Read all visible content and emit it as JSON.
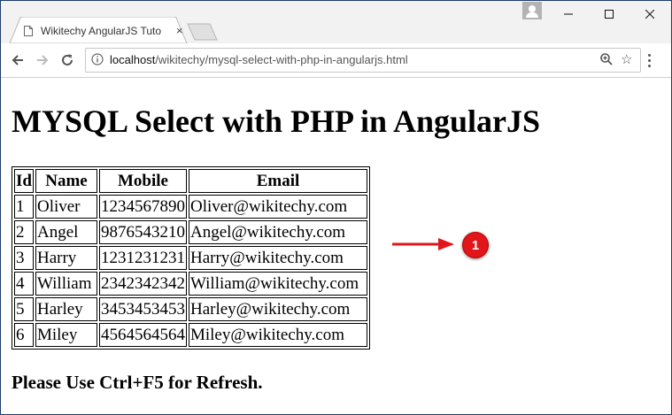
{
  "browser": {
    "tab_title": "Wikitechy AngularJS Tuto",
    "tab_close": "×",
    "url_host": "localhost",
    "url_path": "/wikitechy/mysql-select-with-php-in-angularjs.html",
    "window_controls": {
      "minimize": "—",
      "maximize": "☐",
      "close": "✕"
    },
    "icons": [
      "back-arrow-icon",
      "forward-arrow-icon",
      "reload-icon",
      "info-icon",
      "zoom-icon",
      "star-icon",
      "menu-icon",
      "profile-icon"
    ]
  },
  "page": {
    "heading": "MYSQL Select with PHP in AngularJS",
    "table": {
      "headers": [
        "Id",
        "Name",
        "Mobile",
        "Email"
      ],
      "rows": [
        [
          "1",
          "Oliver",
          "1234567890",
          "Oliver@wikitechy.com"
        ],
        [
          "2",
          "Angel",
          "9876543210",
          "Angel@wikitechy.com"
        ],
        [
          "3",
          "Harry",
          "1231231231",
          "Harry@wikitechy.com"
        ],
        [
          "4",
          "William",
          "2342342342",
          "William@wikitechy.com"
        ],
        [
          "5",
          "Harley",
          "3453453453",
          "Harley@wikitechy.com"
        ],
        [
          "6",
          "Miley",
          "4564564564",
          "Miley@wikitechy.com"
        ]
      ]
    },
    "refresh_note": "Please Use Ctrl+F5 for Refresh.",
    "annotation_badge": "1",
    "annotation_color": "#e0161a"
  }
}
